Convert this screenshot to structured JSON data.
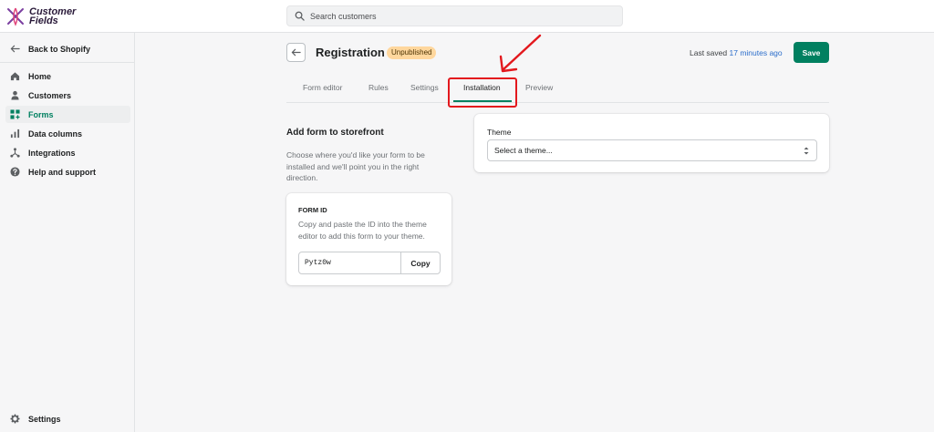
{
  "app": {
    "logo_line1": "Customer",
    "logo_line2": "Fields"
  },
  "search": {
    "placeholder": "Search customers"
  },
  "sidebar": {
    "back_label": "Back to Shopify",
    "items": [
      {
        "label": "Home",
        "icon": "home-icon"
      },
      {
        "label": "Customers",
        "icon": "person-icon"
      },
      {
        "label": "Forms",
        "icon": "forms-icon",
        "active": true
      },
      {
        "label": "Data columns",
        "icon": "bar-chart-icon"
      },
      {
        "label": "Integrations",
        "icon": "integrations-icon"
      },
      {
        "label": "Help and support",
        "icon": "help-icon"
      }
    ],
    "settings_label": "Settings"
  },
  "header": {
    "title": "Registration",
    "badge": "Unpublished",
    "last_saved_prefix": "Last saved",
    "last_saved_time": "17 minutes ago",
    "save_label": "Save"
  },
  "tabs": [
    {
      "label": "Form editor"
    },
    {
      "label": "Rules"
    },
    {
      "label": "Settings"
    },
    {
      "label": "Installation",
      "active": true
    },
    {
      "label": "Preview"
    }
  ],
  "installation": {
    "title": "Add form to storefront",
    "description": "Choose where you'd like your form to be installed and we'll point you in the right direction.",
    "form_id_card": {
      "label": "FORM ID",
      "help": "Copy and paste the ID into the theme editor to add this form to your theme.",
      "value": "Pytz0w",
      "copy_label": "Copy"
    },
    "theme_card": {
      "label": "Theme",
      "selected": "Select a theme..."
    }
  },
  "colors": {
    "accent": "#008060",
    "annotation": "#e3181d",
    "badge_bg": "#ffd79d"
  }
}
